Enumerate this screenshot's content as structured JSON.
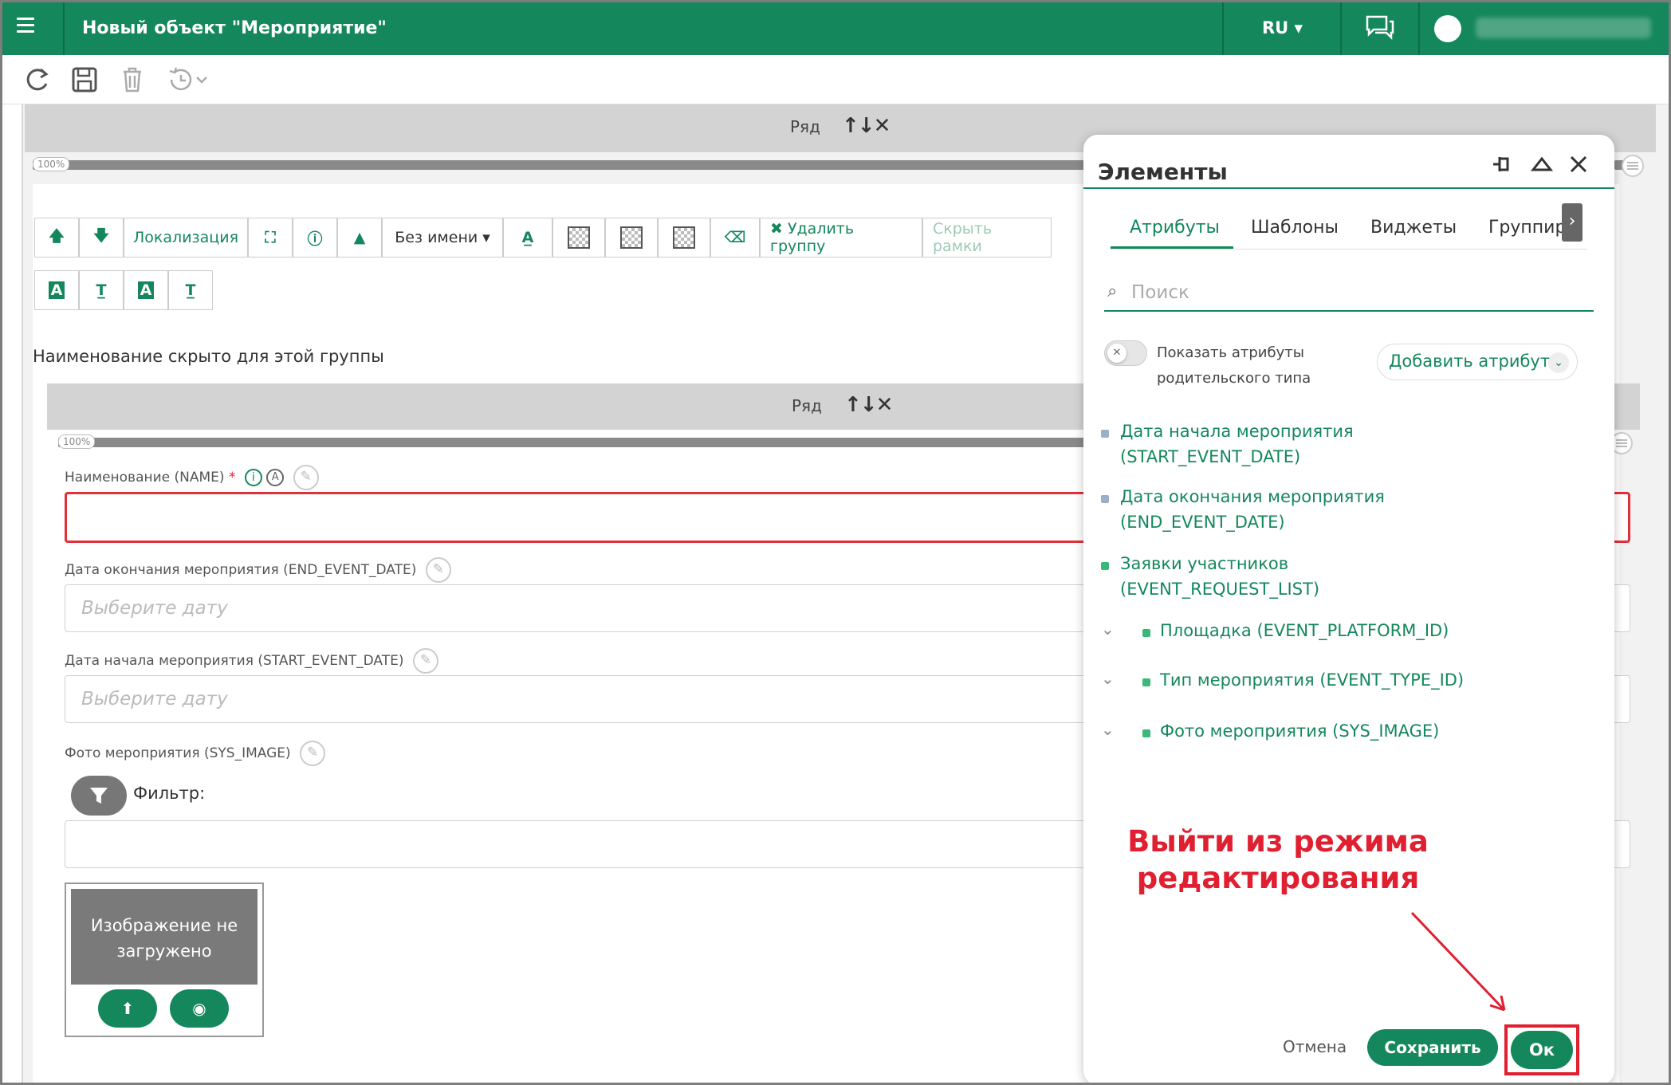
{
  "topbar": {
    "title": "Новый объект \"Мероприятие\"",
    "lang": "RU ▾",
    "accent": "#14875c"
  },
  "toolbar": {
    "icons": [
      "refresh-icon",
      "save-icon",
      "delete-icon",
      "history-icon"
    ]
  },
  "outer_row": {
    "label": "Ряд",
    "arrows": "↑↓✕",
    "percent": "100%"
  },
  "group_tools": {
    "localization": "Локализация",
    "no_name": "Без имени ▾",
    "delete_group": "✖ Удалить группу",
    "hide_frames": "Скрыть рамки"
  },
  "group_hidden_text": "Наименование скрыто для этой группы",
  "inner_row": {
    "label": "Ряд",
    "arrows": "↑↓✕",
    "percent": "100%"
  },
  "fields": {
    "name_label": "Наименование (NAME)",
    "required_mark": "*",
    "end_date_label": "Дата окончания мероприятия (END_EVENT_DATE)",
    "end_date_placeholder": "Выберите дату",
    "start_date_label": "Дата начала мероприятия (START_EVENT_DATE)",
    "start_date_placeholder": "Выберите дату",
    "photo_label": "Фото мероприятия (SYS_IMAGE)",
    "filter_label": "Фильтр:",
    "no_image": "Изображение не загружено"
  },
  "panel": {
    "title": "Элементы",
    "tabs": [
      "Атрибуты",
      "Шаблоны",
      "Виджеты",
      "Группиро"
    ],
    "search_placeholder": "Поиск",
    "show_parent_attrs": "Показать атрибуты родительского типа",
    "add_attribute": "Добавить атрибут",
    "attributes": [
      {
        "line1": "Дата начала мероприятия",
        "line2": "(START_EVENT_DATE)"
      },
      {
        "line1": "Дата окончания мероприятия",
        "line2": "(END_EVENT_DATE)"
      },
      {
        "line1": "Заявки участников",
        "line2": "(EVENT_REQUEST_LIST)"
      }
    ],
    "expandable": [
      "Площадка (EVENT_PLATFORM_ID)",
      "Тип мероприятия (EVENT_TYPE_ID)",
      "Фото мероприятия (SYS_IMAGE)"
    ],
    "cancel": "Отмена",
    "save": "Сохранить",
    "ok": "Ок"
  },
  "annotation": {
    "line1": "Выйти из режима",
    "line2": "редактирования",
    "color": "#e02030"
  }
}
